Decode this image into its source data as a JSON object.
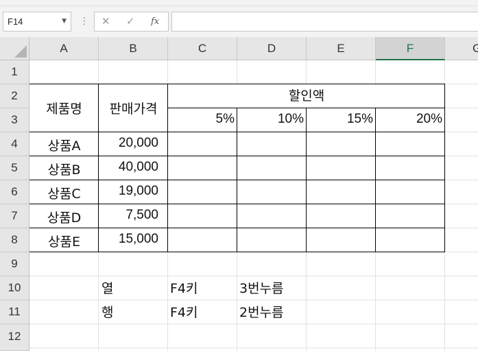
{
  "name_box": {
    "value": "F14"
  },
  "formula_bar": {
    "cancel_glyph": "✕",
    "enter_glyph": "✓",
    "fx_label": "fx",
    "formula": ""
  },
  "columns": [
    "A",
    "B",
    "C",
    "D",
    "E",
    "F",
    "G"
  ],
  "selected_column": "F",
  "rows": [
    "1",
    "2",
    "3",
    "4",
    "5",
    "6",
    "7",
    "8",
    "9",
    "10",
    "11",
    "12"
  ],
  "table": {
    "header_product": "제품명",
    "header_price": "판매가격",
    "header_discount": "할인액",
    "rates": [
      "5%",
      "10%",
      "15%",
      "20%"
    ],
    "items": [
      {
        "name": "상품A",
        "price": "20,000"
      },
      {
        "name": "상품B",
        "price": "40,000"
      },
      {
        "name": "상품C",
        "price": "19,000"
      },
      {
        "name": "상품D",
        "price": "7,500"
      },
      {
        "name": "상품E",
        "price": "15,000"
      }
    ]
  },
  "notes": [
    {
      "label": "열",
      "key": "F4키",
      "action": "3번누름"
    },
    {
      "label": "행",
      "key": "F4키",
      "action": "2번누름"
    }
  ]
}
